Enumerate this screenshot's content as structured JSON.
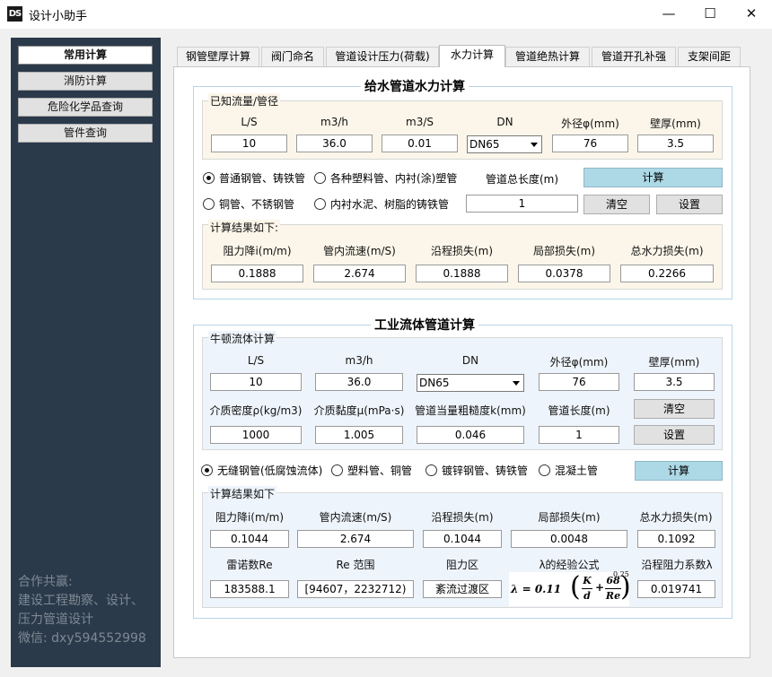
{
  "window": {
    "icon_text": "DS",
    "title": "设计小助手",
    "minimize": "—",
    "maximize": "☐",
    "close": "✕"
  },
  "sidebar": {
    "items": [
      {
        "label": "常用计算"
      },
      {
        "label": "消防计算"
      },
      {
        "label": "危险化学品查询"
      },
      {
        "label": "管件查询"
      }
    ],
    "contact": [
      "合作共赢:",
      "建设工程勘察、设计、",
      "压力管道设计",
      "微信: dxy594552998"
    ]
  },
  "tabs": [
    {
      "label": "钢管壁厚计算"
    },
    {
      "label": "阀门命名"
    },
    {
      "label": "管道设计压力(荷载)"
    },
    {
      "label": "水力计算"
    },
    {
      "label": "管道绝热计算"
    },
    {
      "label": "管道开孔补强"
    },
    {
      "label": "支架间距"
    }
  ],
  "water": {
    "title": "给水管道水力计算",
    "known_title": "已知流量/管径",
    "labels": [
      "L/S",
      "m3/h",
      "m3/S",
      "DN",
      "外径φ(mm)",
      "壁厚(mm)"
    ],
    "values": {
      "ls": "10",
      "m3h": "36.0",
      "m3s": "0.01",
      "dn": "DN65",
      "od": "76",
      "wall": "3.5"
    },
    "radios": [
      {
        "label": "普通钢管、铸铁管",
        "checked": true
      },
      {
        "label": "各种塑料管、内衬(涂)塑管",
        "checked": false
      },
      {
        "label": "铜管、不锈钢管",
        "checked": false
      },
      {
        "label": "内衬水泥、树脂的铸铁管",
        "checked": false
      }
    ],
    "length_label": "管道总长度(m)",
    "length_value": "1",
    "calc_btn": "计算",
    "clear_btn": "清空",
    "settings_btn": "设置",
    "result_title": "计算结果如下:",
    "result_labels": [
      "阻力降i(m/m)",
      "管内流速(m/S)",
      "沿程损失(m)",
      "局部损失(m)",
      "总水力损失(m)"
    ],
    "result_values": [
      "0.1888",
      "2.674",
      "0.1888",
      "0.0378",
      "0.2266"
    ]
  },
  "industrial": {
    "title": "工业流体管道计算",
    "newton_title": "牛顿流体计算",
    "labels": [
      "L/S",
      "m3/h",
      "DN",
      "外径φ(mm)",
      "壁厚(mm)"
    ],
    "values": {
      "ls": "10",
      "m3h": "36.0",
      "dn": "DN65",
      "od": "76",
      "wall": "3.5"
    },
    "labels2": [
      "介质密度ρ(kg/m3)",
      "介质黏度μ(mPa·s)",
      "管道当量粗糙度k(mm)",
      "管道长度(m)"
    ],
    "values2": [
      "1000",
      "1.005",
      "0.046",
      "1"
    ],
    "clear_btn": "清空",
    "settings_btn": "设置",
    "radios": [
      {
        "label": "无缝钢管(低腐蚀流体)",
        "checked": true
      },
      {
        "label": "塑料管、铜管",
        "checked": false
      },
      {
        "label": "镀锌钢管、铸铁管",
        "checked": false
      },
      {
        "label": "混凝土管",
        "checked": false
      }
    ],
    "calc_btn": "计算",
    "result_title": "计算结果如下",
    "result_labels": [
      "阻力降i(m/m)",
      "管内流速(m/S)",
      "沿程损失(m)",
      "局部损失(m)",
      "总水力损失(m)"
    ],
    "result_values": [
      "0.1044",
      "2.674",
      "0.1044",
      "0.0048",
      "0.1092"
    ],
    "result_labels2": [
      "雷诺数Re",
      "Re 范围",
      "阻力区",
      "λ的经验公式",
      "沿程阻力系数λ"
    ],
    "result_values2": [
      "183588.1",
      "[94607，2232712)",
      "紊流过渡区",
      "",
      "0.019741"
    ],
    "formula": {
      "lhs": "λ = 0.11",
      "k": "K",
      "d": "d",
      "n": "68",
      "re": "Re",
      "exp": "0.25"
    }
  }
}
